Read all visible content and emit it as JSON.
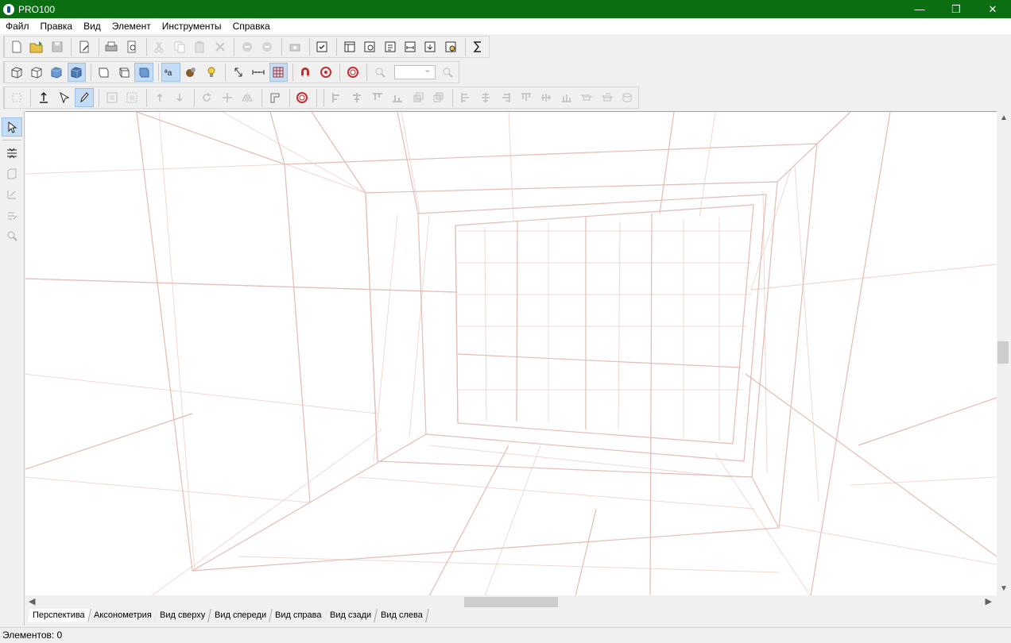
{
  "window": {
    "title": "PRO100",
    "minimize_glyph": "—",
    "maximize_glyph": "❐",
    "close_glyph": "✕"
  },
  "menu": {
    "items": [
      "Файл",
      "Правка",
      "Вид",
      "Элемент",
      "Инструменты",
      "Справка"
    ]
  },
  "toolbar1": {
    "icons": [
      "new-file-icon",
      "open-folder-icon",
      "save-icon",
      "edit-properties-icon",
      "print-icon",
      "print-preview-icon",
      "cut-icon",
      "copy-icon",
      "paste-icon",
      "delete-icon",
      "undo-icon",
      "redo-icon",
      "camera-icon",
      "checklist-icon",
      "report-table-icon",
      "report-preview-icon",
      "report-settings-icon",
      "report-dimensions-icon",
      "report-export-icon",
      "report-cost-icon",
      "sum-icon"
    ]
  },
  "toolbar2": {
    "icons": [
      "wireframe-cube-icon",
      "outline-cube-icon",
      "shaded-cube-icon",
      "textured-cube-icon",
      "wireframe-view-icon",
      "outline-view-icon",
      "shaded-view-icon",
      "text-labels-icon",
      "materials-icon",
      "lightbulb-icon",
      "dimension-icon",
      "measure-icon",
      "grid-icon",
      "magnet-icon",
      "snap-target-icon",
      "center-view-icon",
      "zoom-out-icon",
      "zoom-in-icon"
    ],
    "zoom_value": ""
  },
  "toolbar3": {
    "icons": [
      "select-all-icon",
      "move-up-icon",
      "rotate-cursor-icon",
      "draw-pencil-icon",
      "group-icon",
      "ungroup-icon",
      "raise-icon",
      "lower-icon",
      "rotate-icon",
      "move-icon",
      "mirror-icon",
      "attach-icon",
      "center-target-icon",
      "align-left-icon",
      "align-hcenter-icon",
      "align-top-icon",
      "align-bottom-icon",
      "align-front-icon",
      "align-back-icon",
      "distribute-left-icon",
      "distribute-center-icon",
      "distribute-right-icon",
      "distribute-top-icon",
      "distribute-middle-icon",
      "distribute-bottom-icon",
      "stack-1-icon",
      "stack-2-icon",
      "stack-3-icon"
    ]
  },
  "left_toolbar": {
    "icons": [
      "select-arrow-icon",
      "split-panel-icon",
      "box-icon",
      "resize-icon",
      "edit-icon",
      "search-zoom-icon"
    ]
  },
  "tabs": [
    "Перспектива",
    "Аксонометрия",
    "Вид сверху",
    "Вид спереди",
    "Вид справа",
    "Вид сзади",
    "Вид слева"
  ],
  "status": {
    "text": "Элементов: 0"
  },
  "colors": {
    "titlebar": "#0b6e12",
    "grid_line": "#e3bcb4",
    "grid_line_light": "#f0d8d2",
    "active_button": "#c4dcf5"
  }
}
